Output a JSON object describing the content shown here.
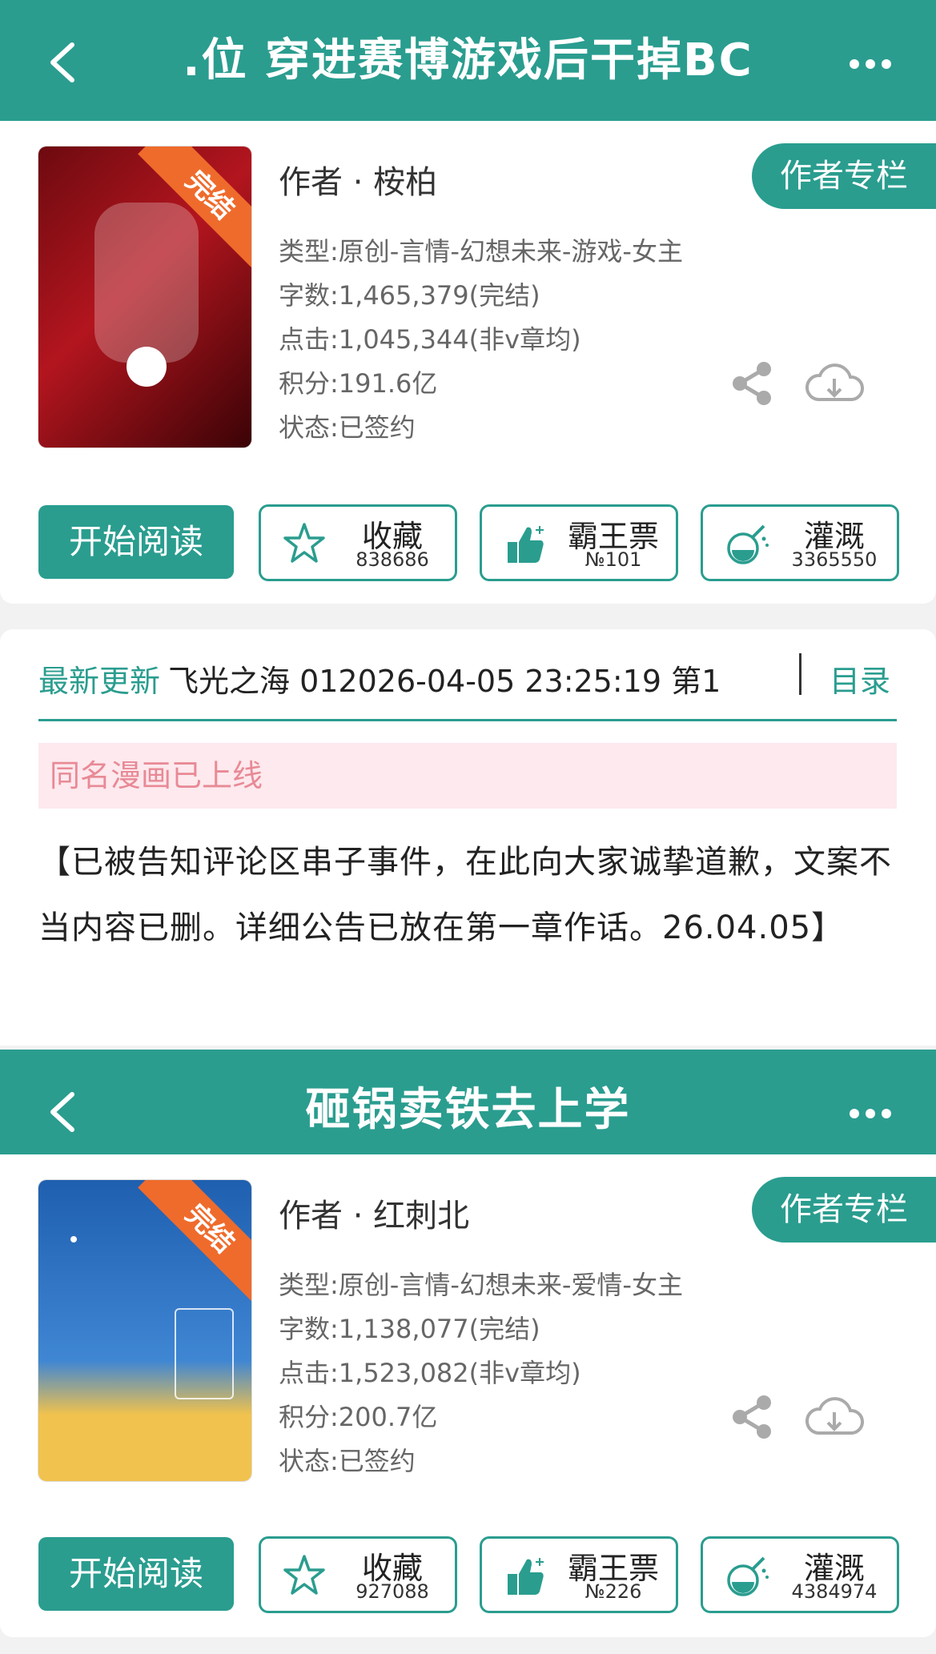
{
  "books": [
    {
      "header_title": ".位  穿进赛博游戏后干掉BC",
      "author": "作者 · 桉柏",
      "author_column_label": "作者专栏",
      "badge": "完结",
      "category": "类型:原创-言情-幻想未来-游戏-女主",
      "word_count": "字数:1,465,379(完结)",
      "clicks": "点击:1,045,344(非v章均)",
      "score": "积分:191.6亿",
      "status": "状态:已签约",
      "read_label": "开始阅读",
      "fav_label": "收藏",
      "fav_count": "838686",
      "vote_label": "霸王票",
      "vote_rank": "№101",
      "water_label": "灌溉",
      "water_count": "3365550",
      "cover_colors": [
        "#8b0d14",
        "#c21d25"
      ]
    },
    {
      "header_title": "砸锅卖铁去上学",
      "author": "作者 · 红刺北",
      "author_column_label": "作者专栏",
      "badge": "完结",
      "category": "类型:原创-言情-幻想未来-爱情-女主",
      "word_count": "字数:1,138,077(完结)",
      "clicks": "点击:1,523,082(非v章均)",
      "score": "积分:200.7亿",
      "status": "状态:已签约",
      "read_label": "开始阅读",
      "fav_label": "收藏",
      "fav_count": "927088",
      "vote_label": "霸王票",
      "vote_rank": "№226",
      "water_label": "灌溉",
      "water_count": "4384974",
      "cover_colors": [
        "#2a6fc0",
        "#f1c24d"
      ]
    }
  ],
  "update": {
    "label": "最新更新",
    "text": "飞光之海 012026-04-05 23:25:19   第1",
    "toc": "目录"
  },
  "manga_notice": "同名漫画已上线",
  "announcement": "【已被告知评论区串子事件，在此向大家诚挚道歉，文案不当内容已删。详细公告已放在第一章作话。26.04.05】",
  "colors": {
    "accent": "#2a9d8f",
    "ribbon": "#ef6b2c",
    "manga_bg": "#fde9ee"
  }
}
